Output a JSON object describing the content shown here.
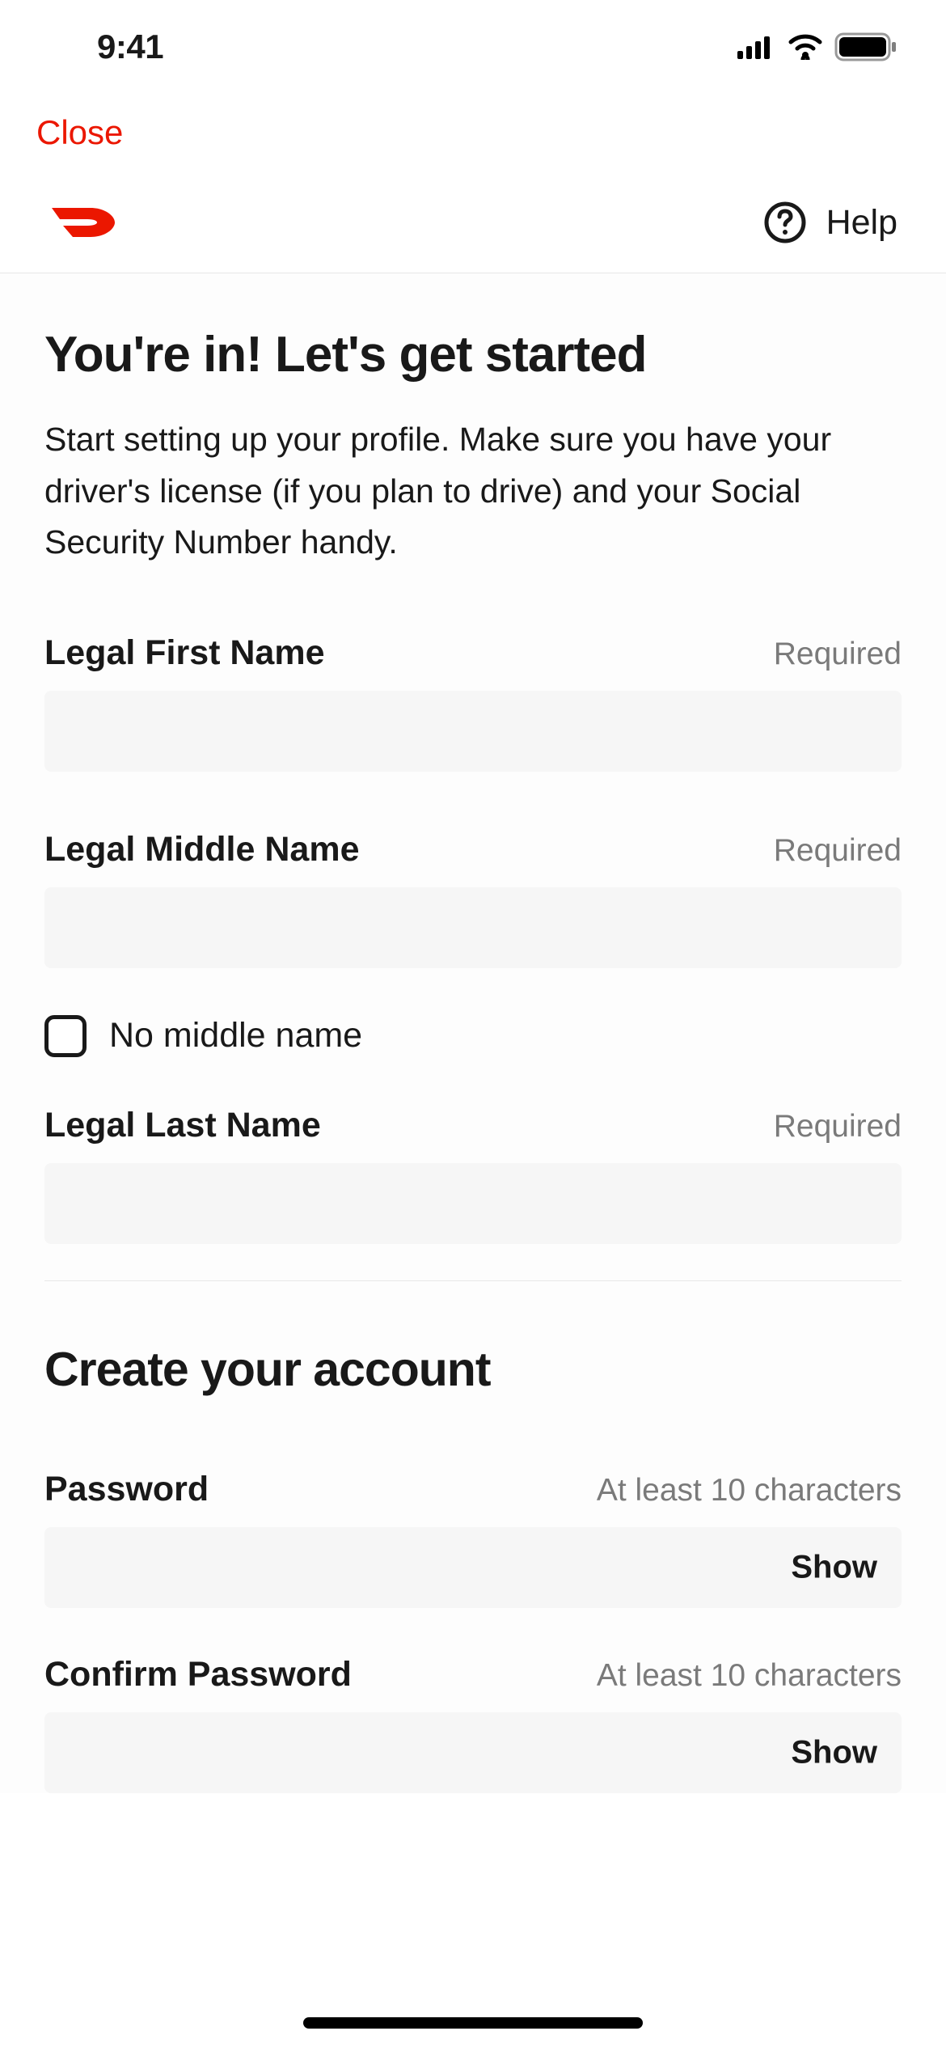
{
  "status": {
    "time": "9:41"
  },
  "nav": {
    "close": "Close"
  },
  "header": {
    "help": "Help"
  },
  "page": {
    "title": "You're in! Let's get started",
    "subtitle": "Start setting up your profile. Make sure you have your driver's license (if you plan to drive) and your Social Security Number handy."
  },
  "fields": {
    "first_name": {
      "label": "Legal First Name",
      "hint": "Required",
      "value": ""
    },
    "middle_name": {
      "label": "Legal Middle Name",
      "hint": "Required",
      "value": ""
    },
    "no_middle": {
      "label": "No middle name"
    },
    "last_name": {
      "label": "Legal Last Name",
      "hint": "Required",
      "value": ""
    }
  },
  "account": {
    "title": "Create your account",
    "password": {
      "label": "Password",
      "hint": "At least 10 characters",
      "show": "Show",
      "value": ""
    },
    "confirm": {
      "label": "Confirm Password",
      "hint": "At least 10 characters",
      "show": "Show",
      "value": ""
    }
  }
}
